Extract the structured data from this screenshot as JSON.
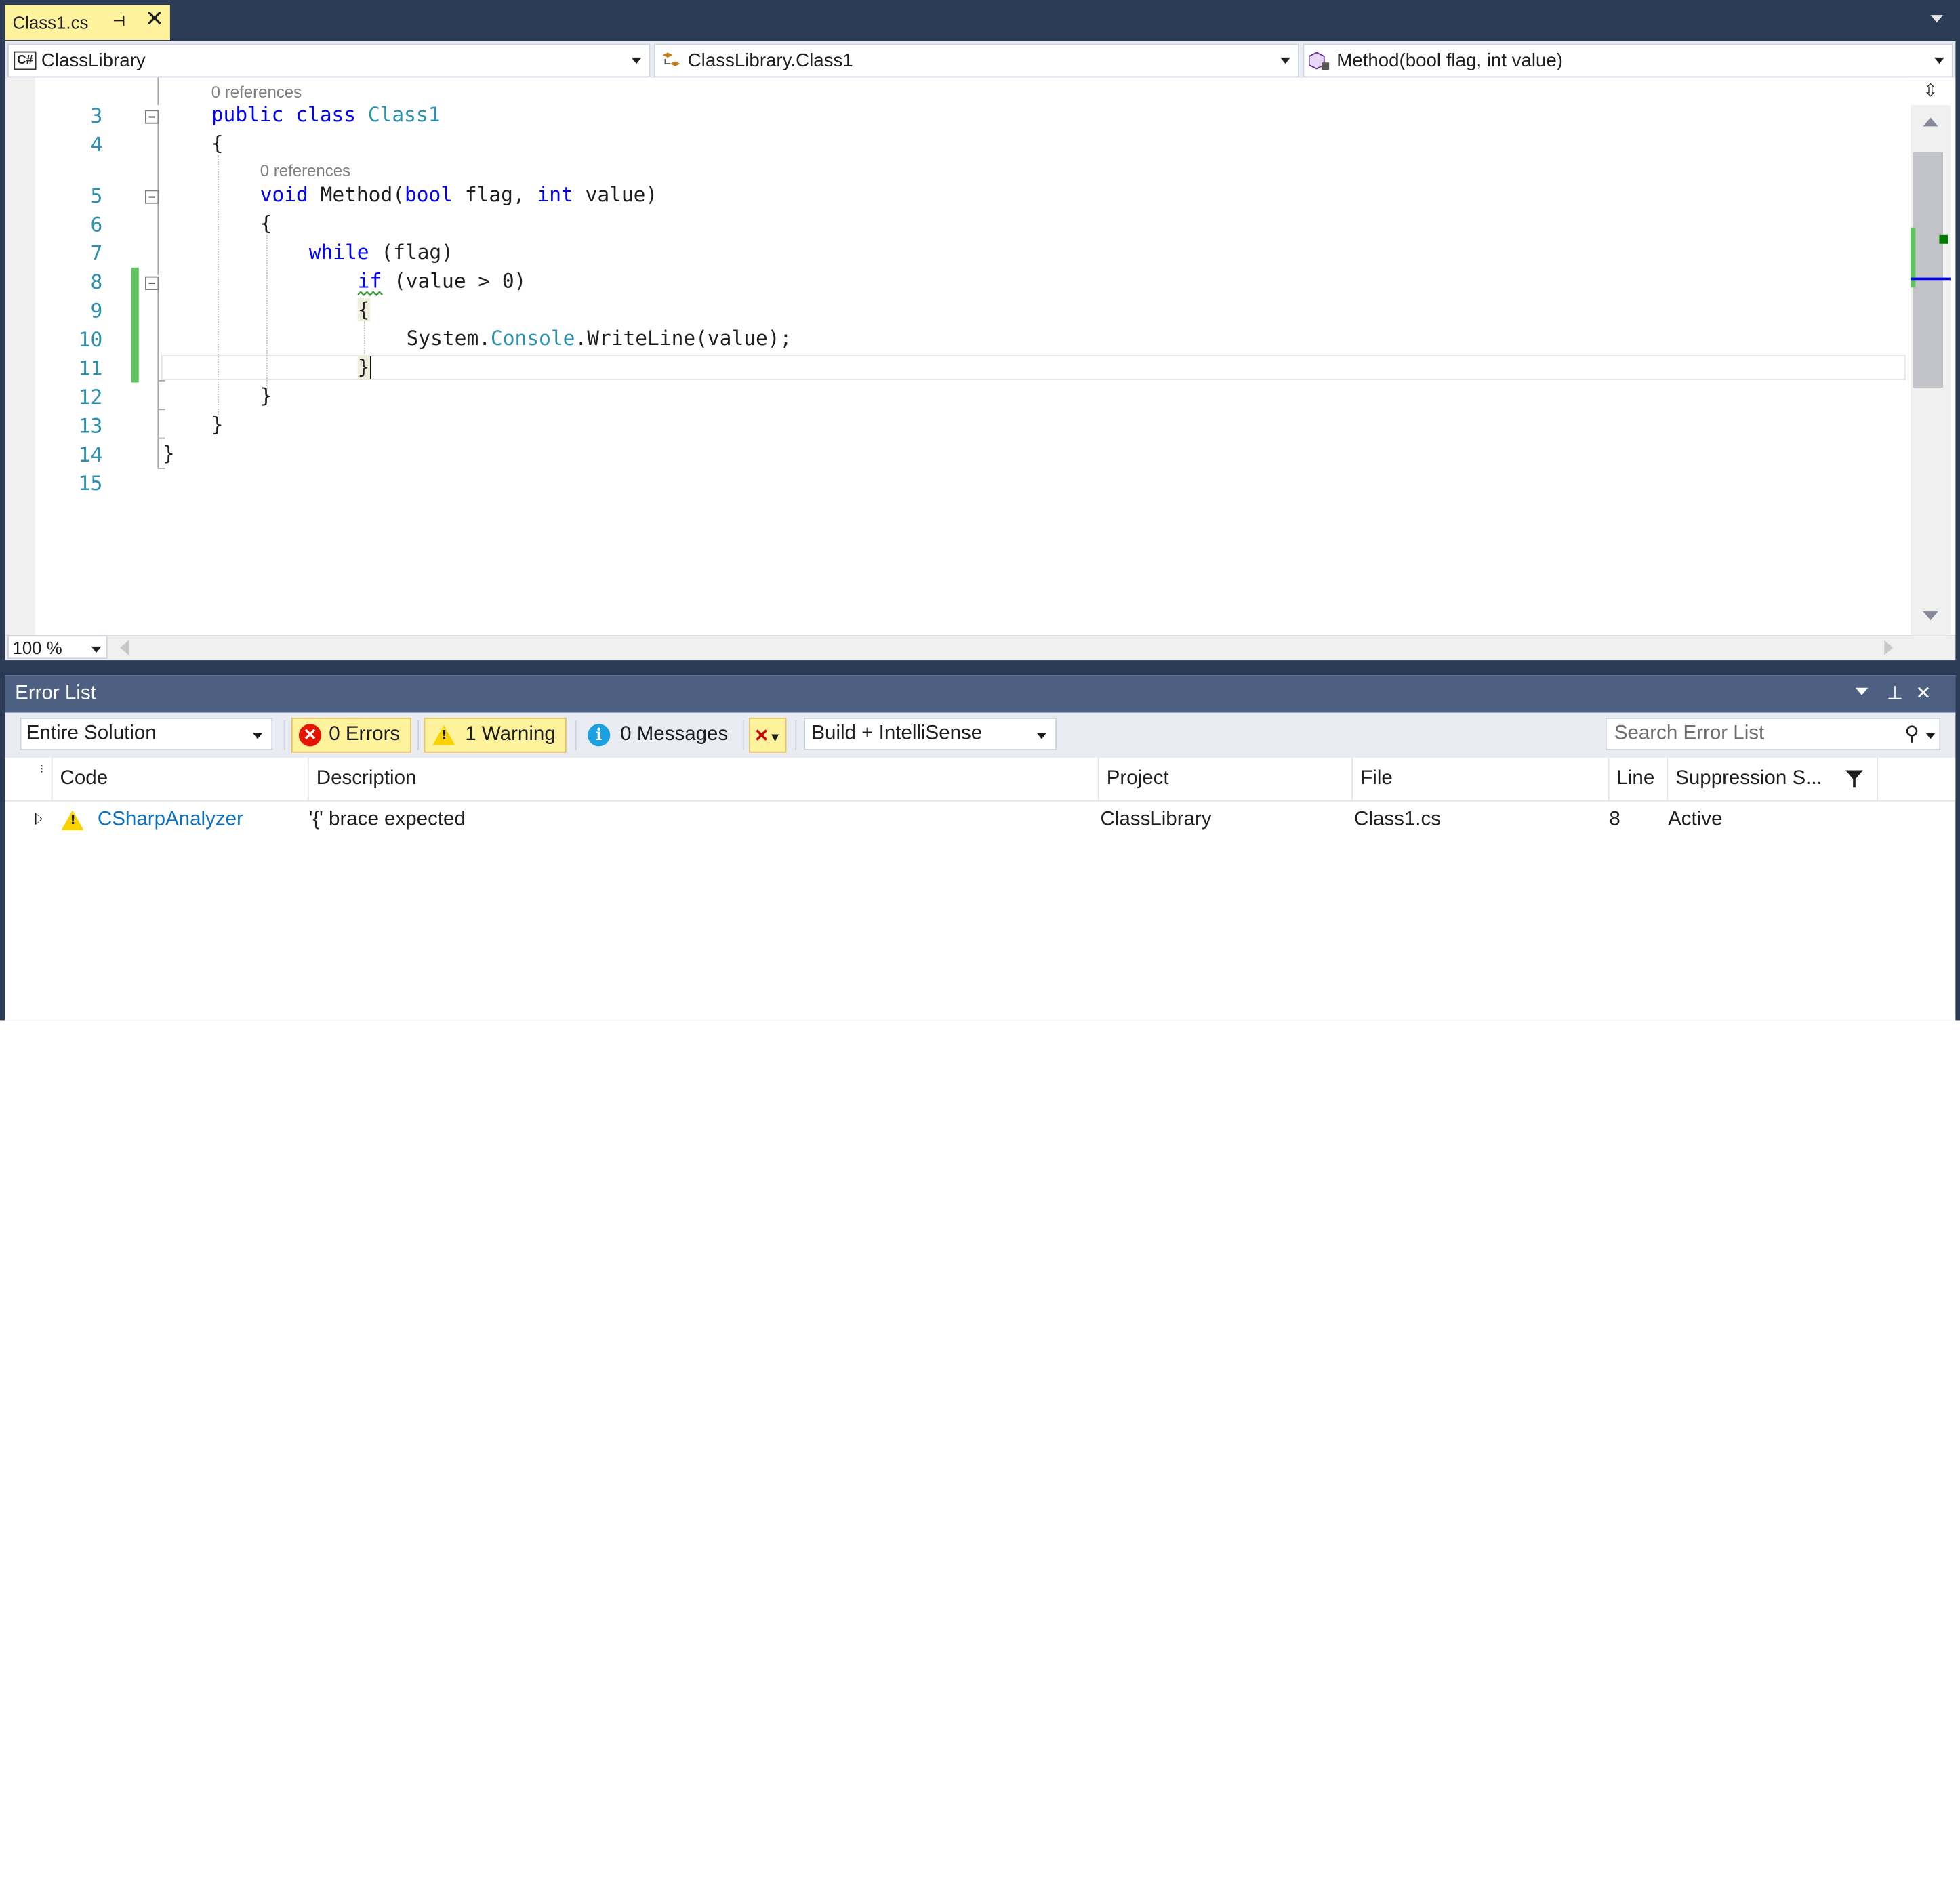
{
  "tab": {
    "title": "Class1.cs",
    "pin_icon": "pin-icon",
    "close_icon": "close-icon"
  },
  "navbar": {
    "project": "ClassLibrary",
    "type": "ClassLibrary.Class1",
    "member": "Method(bool flag, int value)"
  },
  "editor": {
    "refs_class": "0 references",
    "refs_method": "0 references",
    "line_numbers": [
      "3",
      "4",
      "5",
      "6",
      "7",
      "8",
      "9",
      "10",
      "11",
      "12",
      "13",
      "14",
      "15"
    ],
    "lines": {
      "l3": {
        "kw1": "public",
        "kw2": "class",
        "type": "Class1"
      },
      "l4": "{",
      "l5": {
        "kw1": "void",
        "name": " Method(",
        "kw2": "bool",
        "mid": " flag, ",
        "kw3": "int",
        "end": " value)"
      },
      "l6": "{",
      "l7": {
        "kw": "while",
        "rest": " (flag)"
      },
      "l8": {
        "kw": "if",
        "rest": " (value > 0)"
      },
      "l9": "{",
      "l10": {
        "a": "System.",
        "type": "Console",
        "b": ".WriteLine(value);"
      },
      "l11": "}",
      "l12": "}",
      "l13": "}",
      "l14": "}"
    },
    "zoom": "100 %"
  },
  "error_list": {
    "title": "Error List",
    "scope": "Entire Solution",
    "errors": "0 Errors",
    "warnings": "1 Warning",
    "messages": "0 Messages",
    "source": "Build + IntelliSense",
    "search_placeholder": "Search Error List",
    "columns": [
      "Code",
      "Description",
      "Project",
      "File",
      "Line",
      "Suppression S..."
    ],
    "rows": [
      {
        "code": "CSharpAnalyzer",
        "description": "'{' brace expected",
        "project": "ClassLibrary",
        "file": "Class1.cs",
        "line": "8",
        "suppression": "Active"
      }
    ]
  },
  "colors": {
    "accent_tab": "#fff29d",
    "chrome": "#2b3a55",
    "panel_title": "#4d6082",
    "keyword": "#0000ff",
    "type": "#2b91af",
    "change_bar": "#5fc45f"
  }
}
